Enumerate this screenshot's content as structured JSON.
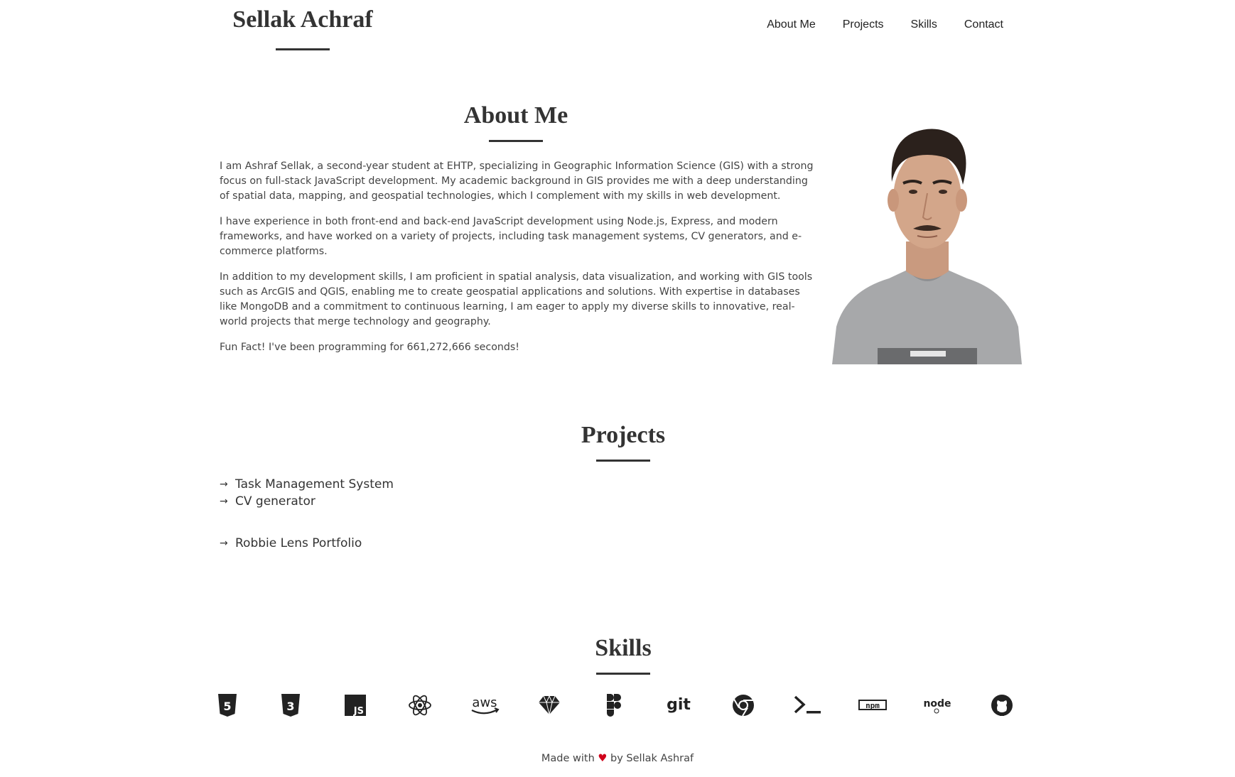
{
  "header": {
    "brand": "Sellak Achraf",
    "nav": [
      "About Me",
      "Projects",
      "Skills",
      "Contact"
    ]
  },
  "about": {
    "title": "About Me",
    "paragraphs": [
      "I am Ashraf Sellak, a second-year student at EHTP, specializing in Geographic Information Science (GIS) with a strong focus on full-stack JavaScript development. My academic background in GIS provides me with a deep understanding of spatial data, mapping, and geospatial technologies, which I complement with my skills in web development.",
      "I have experience in both front-end and back-end JavaScript development using Node.js, Express, and modern frameworks, and have worked on a variety of projects, including task management systems, CV generators, and e-commerce platforms.",
      "In addition to my development skills, I am proficient in spatial analysis, data visualization, and working with GIS tools such as ArcGIS and QGIS, enabling me to create geospatial applications and solutions. With expertise in databases like MongoDB and a commitment to continuous learning, I am eager to apply my diverse skills to innovative, real-world projects that merge technology and geography.",
      "Fun Fact! I've been programming for 661,272,666 seconds!"
    ]
  },
  "projects": {
    "title": "Projects",
    "arrow": "→",
    "items": [
      "Task Management System",
      "CV generator",
      "Robbie Lens Portfolio"
    ]
  },
  "skills": {
    "title": "Skills",
    "icons": [
      {
        "name": "html5-icon",
        "label": "5"
      },
      {
        "name": "css3-icon",
        "label": "3"
      },
      {
        "name": "javascript-icon",
        "label": "JS"
      },
      {
        "name": "react-icon",
        "label": ""
      },
      {
        "name": "aws-icon",
        "label": "aws"
      },
      {
        "name": "sketch-icon",
        "label": ""
      },
      {
        "name": "figma-icon",
        "label": ""
      },
      {
        "name": "git-icon",
        "label": "git"
      },
      {
        "name": "chrome-icon",
        "label": ""
      },
      {
        "name": "terminal-icon",
        "label": ">_"
      },
      {
        "name": "npm-icon",
        "label": "npm"
      },
      {
        "name": "nodejs-icon",
        "label": "node"
      },
      {
        "name": "github-icon",
        "label": ""
      }
    ]
  },
  "footer": {
    "prefix": "Made with",
    "heart": "♥",
    "suffix": "by Sellak Ashraf"
  },
  "colors": {
    "text": "#333333",
    "heart": "#d0021b",
    "background": "#ffffff"
  }
}
